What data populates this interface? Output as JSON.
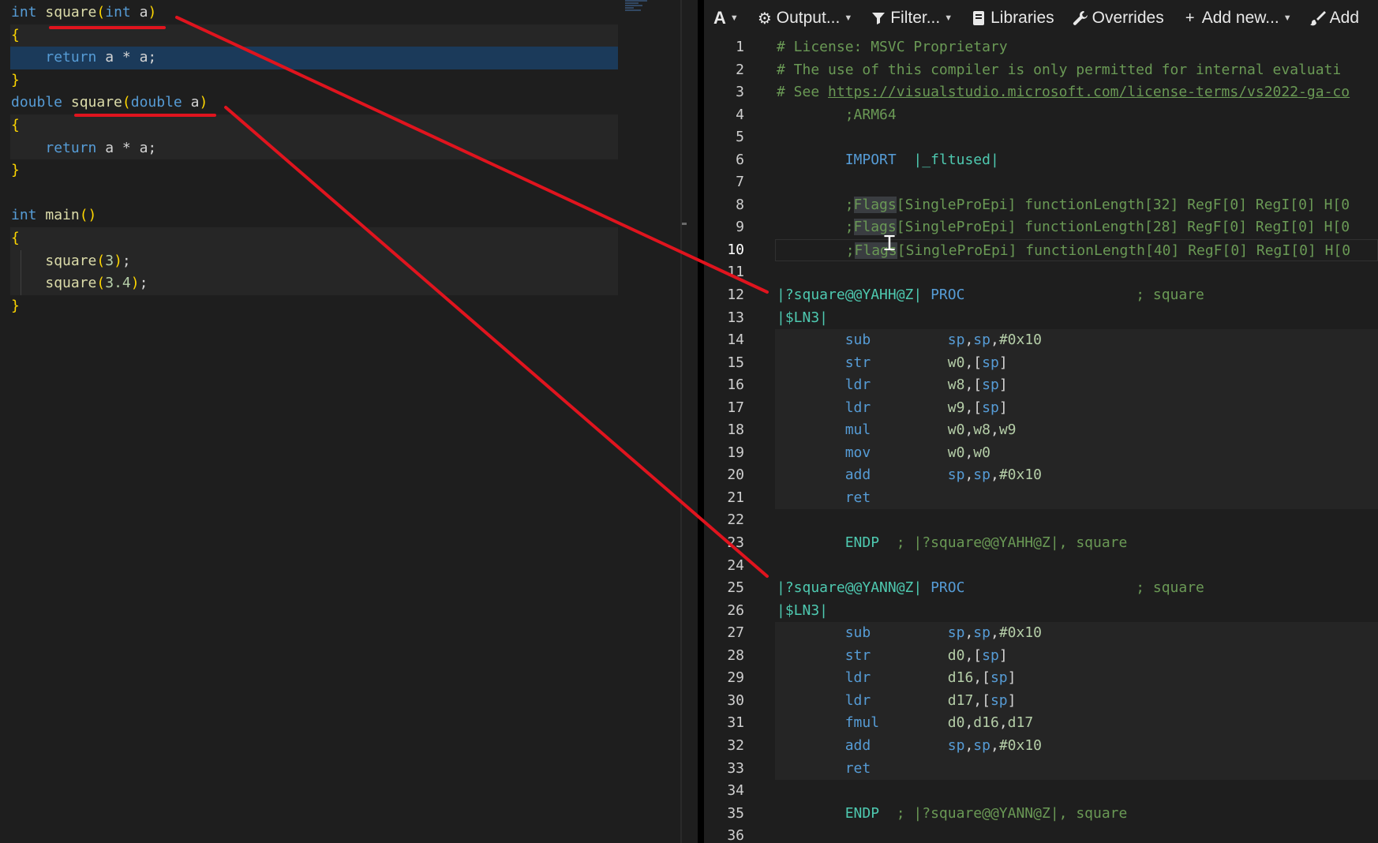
{
  "source": {
    "lines": [
      [
        [
          "c-kw",
          "int"
        ],
        [
          "c-plain",
          " "
        ],
        [
          "c-fn",
          "square"
        ],
        [
          "c-brace",
          "("
        ],
        [
          "c-kw",
          "int"
        ],
        [
          "c-plain",
          " a"
        ],
        [
          "c-brace",
          ")"
        ]
      ],
      [
        [
          "c-brace",
          "{"
        ]
      ],
      [
        [
          "c-plain",
          "    "
        ],
        [
          "c-kw",
          "return"
        ],
        [
          "c-plain",
          " a * a;"
        ]
      ],
      [
        [
          "c-brace",
          "}"
        ]
      ],
      [
        [
          "c-kw",
          "double"
        ],
        [
          "c-plain",
          " "
        ],
        [
          "c-fn",
          "square"
        ],
        [
          "c-brace",
          "("
        ],
        [
          "c-kw",
          "double"
        ],
        [
          "c-plain",
          " a"
        ],
        [
          "c-brace",
          ")"
        ]
      ],
      [
        [
          "c-brace",
          "{"
        ]
      ],
      [
        [
          "c-plain",
          "    "
        ],
        [
          "c-kw",
          "return"
        ],
        [
          "c-plain",
          " a * a;"
        ]
      ],
      [
        [
          "c-brace",
          "}"
        ]
      ],
      [
        [
          "c-plain",
          ""
        ]
      ],
      [
        [
          "c-kw",
          "int"
        ],
        [
          "c-plain",
          " "
        ],
        [
          "c-fn",
          "main"
        ],
        [
          "c-brace",
          "()"
        ]
      ],
      [
        [
          "c-brace",
          "{"
        ]
      ],
      [
        [
          "c-plain",
          "    "
        ],
        [
          "c-fn",
          "square"
        ],
        [
          "c-brace",
          "("
        ],
        [
          "c-num",
          "3"
        ],
        [
          "c-brace",
          ")"
        ],
        [
          "c-plain",
          ";"
        ]
      ],
      [
        [
          "c-plain",
          "    "
        ],
        [
          "c-fn",
          "square"
        ],
        [
          "c-brace",
          "("
        ],
        [
          "c-num",
          "3.4"
        ],
        [
          "c-brace",
          ")"
        ],
        [
          "c-plain",
          ";"
        ]
      ],
      [
        [
          "c-brace",
          "}"
        ]
      ]
    ]
  },
  "toolbar": {
    "font_label": "A",
    "output_label": "Output...",
    "filter_label": "Filter...",
    "libraries_label": "Libraries",
    "overrides_label": "Overrides",
    "add_new_label": "Add new...",
    "add_tool_label": "Add"
  },
  "asm": {
    "current_line": 10,
    "lines": [
      {
        "n": "1",
        "t": [
          [
            "c-comment",
            "# License: MSVC Proprietary"
          ]
        ]
      },
      {
        "n": "2",
        "t": [
          [
            "c-comment",
            "# The use of this compiler is only permitted for internal evaluati"
          ]
        ]
      },
      {
        "n": "3",
        "t": [
          [
            "c-comment",
            "# See "
          ],
          [
            "c-link",
            "https://visualstudio.microsoft.com/license-terms/vs2022-ga-co"
          ]
        ]
      },
      {
        "n": "4",
        "t": [
          [
            "c-plain",
            "        "
          ],
          [
            "c-comment",
            ";ARM64"
          ]
        ]
      },
      {
        "n": "5",
        "t": []
      },
      {
        "n": "6",
        "t": [
          [
            "c-plain",
            "        "
          ],
          [
            "c-kw",
            "IMPORT"
          ],
          [
            "c-plain",
            "  "
          ],
          [
            "c-lbl",
            "|_fltused|"
          ]
        ]
      },
      {
        "n": "7",
        "t": []
      },
      {
        "n": "8",
        "t": [
          [
            "c-plain",
            "        "
          ],
          [
            "c-comment",
            ";"
          ],
          [
            "c-flagbox",
            "Flags"
          ],
          [
            "c-comment",
            "[SingleProEpi] functionLength[32] RegF[0] RegI[0] H[0"
          ]
        ]
      },
      {
        "n": "9",
        "t": [
          [
            "c-plain",
            "        "
          ],
          [
            "c-comment",
            ";"
          ],
          [
            "c-flagbox",
            "Flags"
          ],
          [
            "c-comment",
            "[SingleProEpi] functionLength[28] RegF[0] RegI[0] H[0"
          ]
        ]
      },
      {
        "n": "10",
        "t": [
          [
            "c-plain",
            "        "
          ],
          [
            "c-comment",
            ";"
          ],
          [
            "c-flagbox",
            "Flags"
          ],
          [
            "c-comment",
            "[SingleProEpi] functionLength[40] RegF[0] RegI[0] H[0"
          ]
        ]
      },
      {
        "n": "11",
        "t": []
      },
      {
        "n": "12",
        "t": [
          [
            "c-lbl",
            "|?square@@YAHH@Z|"
          ],
          [
            "c-plain",
            " "
          ],
          [
            "c-kw",
            "PROC"
          ],
          [
            "c-plain",
            "                    "
          ],
          [
            "c-comment",
            "; square"
          ]
        ]
      },
      {
        "n": "13",
        "t": [
          [
            "c-lbl",
            "|$LN3|"
          ]
        ]
      },
      {
        "n": "14",
        "hl": true,
        "t": [
          [
            "c-plain",
            "        "
          ],
          [
            "c-op",
            "sub"
          ],
          [
            "c-plain",
            "         "
          ],
          [
            "c-sp",
            "sp"
          ],
          [
            "c-plain",
            ","
          ],
          [
            "c-sp",
            "sp"
          ],
          [
            "c-plain",
            ","
          ],
          [
            "c-num",
            "#0x10"
          ]
        ]
      },
      {
        "n": "15",
        "hl": true,
        "t": [
          [
            "c-plain",
            "        "
          ],
          [
            "c-op",
            "str"
          ],
          [
            "c-plain",
            "         "
          ],
          [
            "c-num",
            "w0"
          ],
          [
            "c-plain",
            ",["
          ],
          [
            "c-sp",
            "sp"
          ],
          [
            "c-plain",
            "]"
          ]
        ]
      },
      {
        "n": "16",
        "hl": true,
        "t": [
          [
            "c-plain",
            "        "
          ],
          [
            "c-op",
            "ldr"
          ],
          [
            "c-plain",
            "         "
          ],
          [
            "c-num",
            "w8"
          ],
          [
            "c-plain",
            ",["
          ],
          [
            "c-sp",
            "sp"
          ],
          [
            "c-plain",
            "]"
          ]
        ]
      },
      {
        "n": "17",
        "hl": true,
        "t": [
          [
            "c-plain",
            "        "
          ],
          [
            "c-op",
            "ldr"
          ],
          [
            "c-plain",
            "         "
          ],
          [
            "c-num",
            "w9"
          ],
          [
            "c-plain",
            ",["
          ],
          [
            "c-sp",
            "sp"
          ],
          [
            "c-plain",
            "]"
          ]
        ]
      },
      {
        "n": "18",
        "hl": true,
        "t": [
          [
            "c-plain",
            "        "
          ],
          [
            "c-op",
            "mul"
          ],
          [
            "c-plain",
            "         "
          ],
          [
            "c-num",
            "w0"
          ],
          [
            "c-plain",
            ","
          ],
          [
            "c-num",
            "w8"
          ],
          [
            "c-plain",
            ","
          ],
          [
            "c-num",
            "w9"
          ]
        ]
      },
      {
        "n": "19",
        "hl": true,
        "t": [
          [
            "c-plain",
            "        "
          ],
          [
            "c-op",
            "mov"
          ],
          [
            "c-plain",
            "         "
          ],
          [
            "c-num",
            "w0"
          ],
          [
            "c-plain",
            ","
          ],
          [
            "c-num",
            "w0"
          ]
        ]
      },
      {
        "n": "20",
        "hl": true,
        "t": [
          [
            "c-plain",
            "        "
          ],
          [
            "c-op",
            "add"
          ],
          [
            "c-plain",
            "         "
          ],
          [
            "c-sp",
            "sp"
          ],
          [
            "c-plain",
            ","
          ],
          [
            "c-sp",
            "sp"
          ],
          [
            "c-plain",
            ","
          ],
          [
            "c-num",
            "#0x10"
          ]
        ]
      },
      {
        "n": "21",
        "hl": true,
        "t": [
          [
            "c-plain",
            "        "
          ],
          [
            "c-op",
            "ret"
          ]
        ]
      },
      {
        "n": "22",
        "t": []
      },
      {
        "n": "23",
        "t": [
          [
            "c-plain",
            "        "
          ],
          [
            "c-endp",
            "ENDP"
          ],
          [
            "c-plain",
            "  "
          ],
          [
            "c-comment",
            "; |?square@@YAHH@Z|, square"
          ]
        ]
      },
      {
        "n": "24",
        "t": []
      },
      {
        "n": "25",
        "t": [
          [
            "c-lbl",
            "|?square@@YANN@Z|"
          ],
          [
            "c-plain",
            " "
          ],
          [
            "c-kw",
            "PROC"
          ],
          [
            "c-plain",
            "                    "
          ],
          [
            "c-comment",
            "; square"
          ]
        ]
      },
      {
        "n": "26",
        "t": [
          [
            "c-lbl",
            "|$LN3|"
          ]
        ]
      },
      {
        "n": "27",
        "hl": true,
        "t": [
          [
            "c-plain",
            "        "
          ],
          [
            "c-op",
            "sub"
          ],
          [
            "c-plain",
            "         "
          ],
          [
            "c-sp",
            "sp"
          ],
          [
            "c-plain",
            ","
          ],
          [
            "c-sp",
            "sp"
          ],
          [
            "c-plain",
            ","
          ],
          [
            "c-num",
            "#0x10"
          ]
        ]
      },
      {
        "n": "28",
        "hl": true,
        "t": [
          [
            "c-plain",
            "        "
          ],
          [
            "c-op",
            "str"
          ],
          [
            "c-plain",
            "         "
          ],
          [
            "c-num",
            "d0"
          ],
          [
            "c-plain",
            ",["
          ],
          [
            "c-sp",
            "sp"
          ],
          [
            "c-plain",
            "]"
          ]
        ]
      },
      {
        "n": "29",
        "hl": true,
        "t": [
          [
            "c-plain",
            "        "
          ],
          [
            "c-op",
            "ldr"
          ],
          [
            "c-plain",
            "         "
          ],
          [
            "c-num",
            "d16"
          ],
          [
            "c-plain",
            ",["
          ],
          [
            "c-sp",
            "sp"
          ],
          [
            "c-plain",
            "]"
          ]
        ]
      },
      {
        "n": "30",
        "hl": true,
        "t": [
          [
            "c-plain",
            "        "
          ],
          [
            "c-op",
            "ldr"
          ],
          [
            "c-plain",
            "         "
          ],
          [
            "c-num",
            "d17"
          ],
          [
            "c-plain",
            ",["
          ],
          [
            "c-sp",
            "sp"
          ],
          [
            "c-plain",
            "]"
          ]
        ]
      },
      {
        "n": "31",
        "hl": true,
        "t": [
          [
            "c-plain",
            "        "
          ],
          [
            "c-op",
            "fmul"
          ],
          [
            "c-plain",
            "        "
          ],
          [
            "c-num",
            "d0"
          ],
          [
            "c-plain",
            ","
          ],
          [
            "c-num",
            "d16"
          ],
          [
            "c-plain",
            ","
          ],
          [
            "c-num",
            "d17"
          ]
        ]
      },
      {
        "n": "32",
        "hl": true,
        "t": [
          [
            "c-plain",
            "        "
          ],
          [
            "c-op",
            "add"
          ],
          [
            "c-plain",
            "         "
          ],
          [
            "c-sp",
            "sp"
          ],
          [
            "c-plain",
            ","
          ],
          [
            "c-sp",
            "sp"
          ],
          [
            "c-plain",
            ","
          ],
          [
            "c-num",
            "#0x10"
          ]
        ]
      },
      {
        "n": "33",
        "hl": true,
        "t": [
          [
            "c-plain",
            "        "
          ],
          [
            "c-op",
            "ret"
          ]
        ]
      },
      {
        "n": "34",
        "t": []
      },
      {
        "n": "35",
        "t": [
          [
            "c-plain",
            "        "
          ],
          [
            "c-endp",
            "ENDP"
          ],
          [
            "c-plain",
            "  "
          ],
          [
            "c-comment",
            "; |?square@@YANN@Z|, square"
          ]
        ]
      },
      {
        "n": "36",
        "t": []
      }
    ]
  },
  "annotation_color": "#e0141e"
}
